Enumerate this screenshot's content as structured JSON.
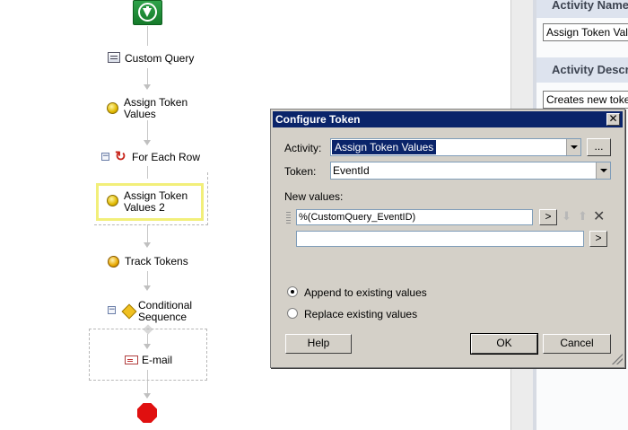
{
  "workflow": {
    "nodes": [
      {
        "label": "Custom Query",
        "icon": "query-icon"
      },
      {
        "label": "Assign Token\nValues",
        "icon": "token-icon"
      },
      {
        "label": "For Each Row",
        "icon": "loop-icon"
      },
      {
        "label": "Assign Token\nValues 2",
        "icon": "token-icon"
      },
      {
        "label": "Track Tokens",
        "icon": "track-icon"
      },
      {
        "label": "Conditional\nSequence",
        "icon": "condition-icon"
      },
      {
        "label": "E-mail",
        "icon": "mail-icon"
      }
    ],
    "collapse_symbol": "⊟"
  },
  "panel": {
    "activity_name_header": "Activity Name",
    "activity_name_value": "Assign Token Values",
    "activity_desc_header": "Activity Description",
    "activity_desc_value": "Creates new tokens"
  },
  "dialog": {
    "title": "Configure Token",
    "close_symbol": "✕",
    "activity_label": "Activity:",
    "activity_value": "Assign Token Values",
    "browse_label": "...",
    "token_label": "Token:",
    "token_value": "EventId",
    "new_values_label": "New values:",
    "values": [
      "%(CustomQuery_EventID)",
      ""
    ],
    "insert_symbol": ">",
    "move_down_symbol": "⬇",
    "move_up_symbol": "⬆",
    "delete_symbol": "✕",
    "options": [
      {
        "label": "Append to existing values",
        "selected": true
      },
      {
        "label": "Replace existing values",
        "selected": false
      }
    ],
    "help_label": "Help",
    "ok_label": "OK",
    "cancel_label": "Cancel"
  },
  "colors": {
    "title_bar": "#0a246a",
    "selection": "#f2ef7a",
    "start": "#1f8f3a",
    "stop": "#e01010"
  }
}
